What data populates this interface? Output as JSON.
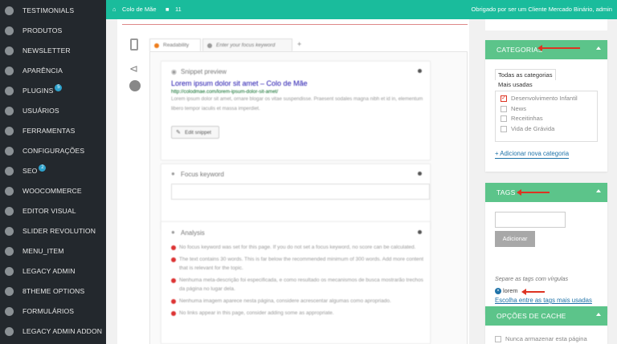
{
  "sidebar": {
    "items": [
      {
        "label": "TESTIMONIALS",
        "icon": "gear-icon"
      },
      {
        "label": "PRODUTOS",
        "icon": "gear-icon"
      },
      {
        "label": "NEWSLETTER",
        "icon": "mail-icon"
      },
      {
        "label": "APARÊNCIA",
        "icon": "brush-icon"
      },
      {
        "label": "PLUGINS",
        "icon": "plug-icon",
        "badge": "5"
      },
      {
        "label": "USUÁRIOS",
        "icon": "user-icon"
      },
      {
        "label": "FERRAMENTAS",
        "icon": "wrench-icon"
      },
      {
        "label": "CONFIGURAÇÕES",
        "icon": "settings-icon"
      },
      {
        "label": "SEO",
        "icon": "seo-icon",
        "badge": "2"
      },
      {
        "label": "WOOCOMMERCE",
        "icon": "woocommerce-icon"
      },
      {
        "label": "EDITOR VISUAL",
        "icon": "editor-icon"
      },
      {
        "label": "SLIDER REVOLUTION",
        "icon": "slider-icon"
      },
      {
        "label": "MENU_ITEM",
        "icon": "menu-icon"
      },
      {
        "label": "LEGACY ADMIN",
        "icon": "gear-icon"
      },
      {
        "label": "8THEME OPTIONS",
        "icon": "theme-icon"
      },
      {
        "label": "FORMULÁRIOS",
        "icon": "form-icon"
      },
      {
        "label": "LEGACY ADMIN ADDON",
        "icon": "gear-icon"
      }
    ]
  },
  "topbar": {
    "site": "Colo de Mãe",
    "comments": "11",
    "greeting": "Obrigado por ser um Cliente Mercado Binário, admin"
  },
  "editor": {
    "tab_readability": "Readability",
    "tab_keyword": "Enter your focus keyword",
    "tab_add": "+",
    "snippet_heading": "Snippet preview",
    "snippet_title": "Lorem ipsum dolor sit amet – Colo de Mãe",
    "snippet_url": "http://colodmae.com/lorem-ipsum-dolor-sit-amet/",
    "snippet_desc": "Lorem ipsum dolor sit amet, ornare blogar os vitae suspendisse. Praesent sodales magna nibh et id in, elementum libero tempor iaculis et massa imperdiet.",
    "edit_snippet": "Edit snippet",
    "focus_heading": "Focus keyword",
    "analysis_heading": "Analysis",
    "analysis_items": [
      "No focus keyword was set for this page. If you do not set a focus keyword, no score can be calculated.",
      "The text contains 30 words. This is far below the recommended minimum of 300 words. Add more content that is relevant for the topic.",
      "Nenhuma meta-descrição foi especificada, e como resultado os mecanismos de busca mostrarão trechos da página no lugar dela.",
      "Nenhuma imagem aparece nesta página, considere acrescentar algumas como apropriado.",
      "No links appear in this page, consider adding some as appropriate."
    ],
    "colors": {
      "red": "#dc3232",
      "orange": "#ee7c1b"
    }
  },
  "categorias": {
    "title": "CATEGORIAS",
    "tab_all": "Todas as categorias",
    "tab_used": "Mais usadas",
    "items": [
      {
        "label": "Desenvolvimento Infantil",
        "checked": true
      },
      {
        "label": "News",
        "checked": false
      },
      {
        "label": "Receitinhas",
        "checked": false
      },
      {
        "label": "Vida de Grávida",
        "checked": false
      }
    ],
    "add_link": "+ Adicionar nova categoria"
  },
  "tags": {
    "title": "TAGS",
    "add_button": "Adicionar",
    "hint": "Separe as tags com vírgulas",
    "tag": "lorem",
    "choose_link": "Escolha entre as tags mais usadas"
  },
  "cache": {
    "title": "OPÇÕES DE CACHE",
    "option": "Nunca armazenar esta página"
  },
  "accent": "#1abc9c"
}
